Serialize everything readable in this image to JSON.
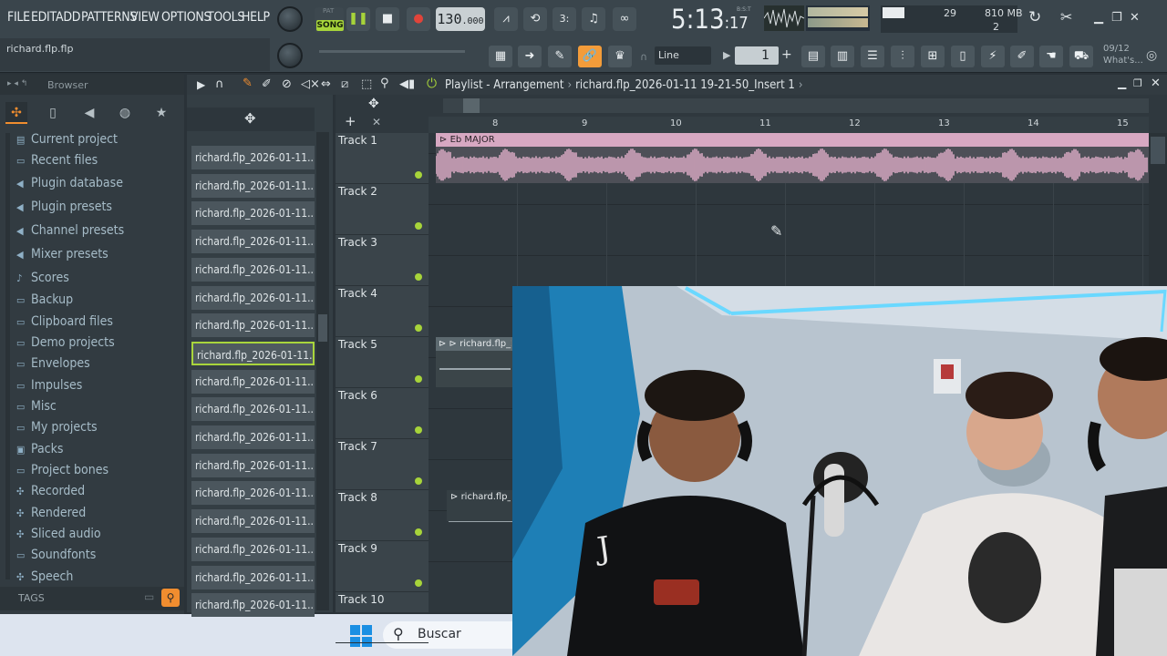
{
  "menu": {
    "items": [
      "FILE",
      "EDIT",
      "ADD",
      "PATTERNS",
      "VIEW",
      "OPTIONS",
      "TOOLS",
      "HELP"
    ]
  },
  "hint": {
    "title": "richard.flp.flp"
  },
  "transport": {
    "pat_label": "PAT",
    "song_label": "SONG",
    "tempo_main": "130",
    "tempo_dec": ".000",
    "clock_main": "5:13",
    "clock_small": ":17",
    "clock_unit": "B:S:T"
  },
  "monitor": {
    "polyphony": "29",
    "memory": "810 MB",
    "voices": "2"
  },
  "toolbar2": {
    "snap": "Line",
    "pattern_number": "1"
  },
  "news": {
    "date": "09/12",
    "text": "What's..."
  },
  "browser": {
    "title": "Browser",
    "items": [
      {
        "label": "Current project",
        "icon": "project-icon"
      },
      {
        "label": "Recent files",
        "icon": "folder-icon"
      },
      {
        "label": "Plugin database",
        "icon": "plugin-icon"
      },
      {
        "label": "Plugin presets",
        "icon": "preset-icon"
      },
      {
        "label": "Channel presets",
        "icon": "preset-icon"
      },
      {
        "label": "Mixer presets",
        "icon": "preset-icon"
      },
      {
        "label": "Scores",
        "icon": "note-icon"
      },
      {
        "label": "Backup",
        "icon": "folder-icon"
      },
      {
        "label": "Clipboard files",
        "icon": "folder-icon"
      },
      {
        "label": "Demo projects",
        "icon": "folder-icon"
      },
      {
        "label": "Envelopes",
        "icon": "folder-icon"
      },
      {
        "label": "Impulses",
        "icon": "folder-icon"
      },
      {
        "label": "Misc",
        "icon": "folder-icon"
      },
      {
        "label": "My projects",
        "icon": "folder-icon"
      },
      {
        "label": "Packs",
        "icon": "packs-icon"
      },
      {
        "label": "Project bones",
        "icon": "folder-icon"
      },
      {
        "label": "Recorded",
        "icon": "mic-icon"
      },
      {
        "label": "Rendered",
        "icon": "render-icon"
      },
      {
        "label": "Sliced audio",
        "icon": "slice-icon"
      },
      {
        "label": "Soundfonts",
        "icon": "folder-icon"
      },
      {
        "label": "Speech",
        "icon": "speech-icon"
      }
    ],
    "tags_label": "TAGS"
  },
  "picker": {
    "items": [
      "richard.flp_2026-01-11...",
      "richard.flp_2026-01-11...",
      "richard.flp_2026-01-11...",
      "richard.flp_2026-01-11...",
      "richard.flp_2026-01-11...",
      "richard.flp_2026-01-11...",
      "richard.flp_2026-01-11...",
      "richard.flp_2026-01-11...",
      "richard.flp_2026-01-11...",
      "richard.flp_2026-01-11...",
      "richard.flp_2026-01-11...",
      "richard.flp_2026-01-11...",
      "richard.flp_2026-01-11...",
      "richard.flp_2026-01-11...",
      "richard.flp_2026-01-11...",
      "richard.flp_2026-01-11...",
      "richard.flp_2026-01-11..."
    ],
    "selected_index": 7
  },
  "playlist": {
    "title_prefix": "Playlist",
    "title_sep": "-",
    "title_view": "Arrangement",
    "title_file": "richard.flp_2026-01-11 19-21-50_Insert 1",
    "ruler": [
      "8",
      "9",
      "10",
      "11",
      "12",
      "13",
      "14",
      "15"
    ],
    "tracks": [
      "Track 1",
      "Track 2",
      "Track 3",
      "Track 4",
      "Track 5",
      "Track 6",
      "Track 7",
      "Track 8",
      "Track 9",
      "Track 10"
    ],
    "clip1_name": "Eb MAJOR",
    "clip5_name": "richard.flp_2026",
    "clip8_name": "richard.flp_"
  },
  "taskbar": {
    "search_text": "Buscar"
  },
  "colors": {
    "accent_green": "#a7d43a",
    "accent_orange": "#f39c3a",
    "clip_pink": "#d7a8c2"
  }
}
